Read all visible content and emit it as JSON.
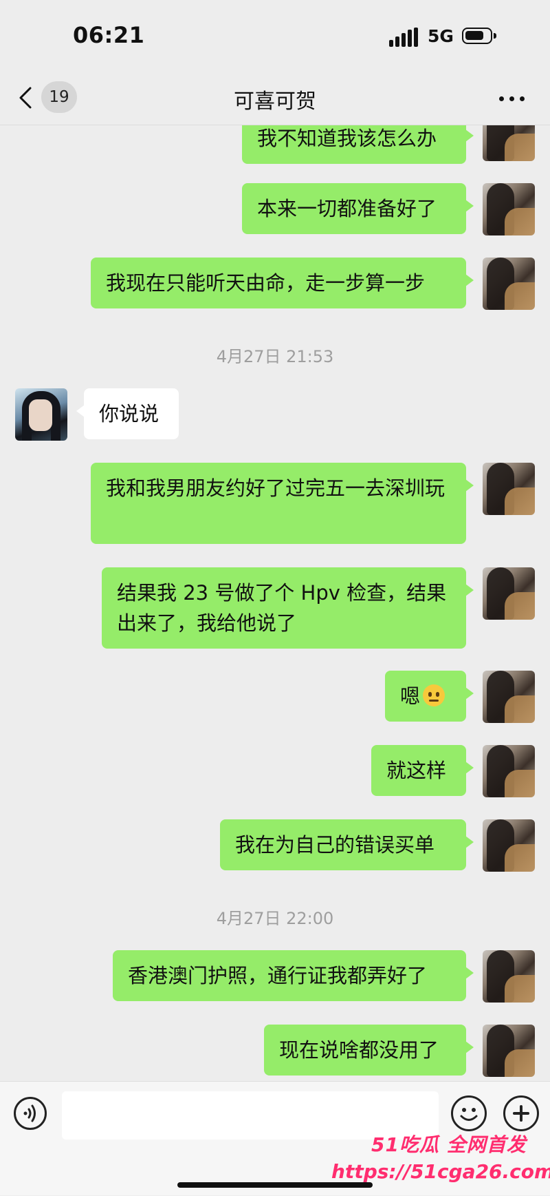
{
  "status_bar": {
    "time": "06:21",
    "network": "5G"
  },
  "header": {
    "unread_count": "19",
    "title": "可喜可贺"
  },
  "messages": [
    {
      "from": "me",
      "text": "我不知道我该怎么办"
    },
    {
      "from": "me",
      "text": "本来一切都准备好了"
    },
    {
      "from": "me",
      "text": "我现在只能听天由命，走一步算一步"
    },
    {
      "from": "timestamp",
      "text": "4月27日 21:53"
    },
    {
      "from": "them",
      "text": "你说说"
    },
    {
      "from": "me",
      "text": "我和我男朋友约好了过完五一去深圳玩"
    },
    {
      "from": "me",
      "text": "结果我 23 号做了个 Hpv 检查，结果出来了，我给他说了"
    },
    {
      "from": "me",
      "text": "嗯",
      "emoji": "neutral-face"
    },
    {
      "from": "me",
      "text": "就这样"
    },
    {
      "from": "me",
      "text": "我在为自己的错误买单"
    },
    {
      "from": "timestamp",
      "text": "4月27日 22:00"
    },
    {
      "from": "me",
      "text": "香港澳门护照，通行证我都弄好了"
    },
    {
      "from": "me",
      "text": "现在说啥都没用了"
    }
  ],
  "input_bar": {
    "text_value": "",
    "icons": [
      "voice-icon",
      "emoji-icon",
      "plus-icon"
    ]
  },
  "watermark": {
    "logo": "51吃瓜 全网首发",
    "url": "https://51cga26.com"
  },
  "colors": {
    "background": "#ededed",
    "outgoing_bubble": "#95ec69",
    "incoming_bubble": "#ffffff",
    "watermark": "#ff2d6f"
  }
}
